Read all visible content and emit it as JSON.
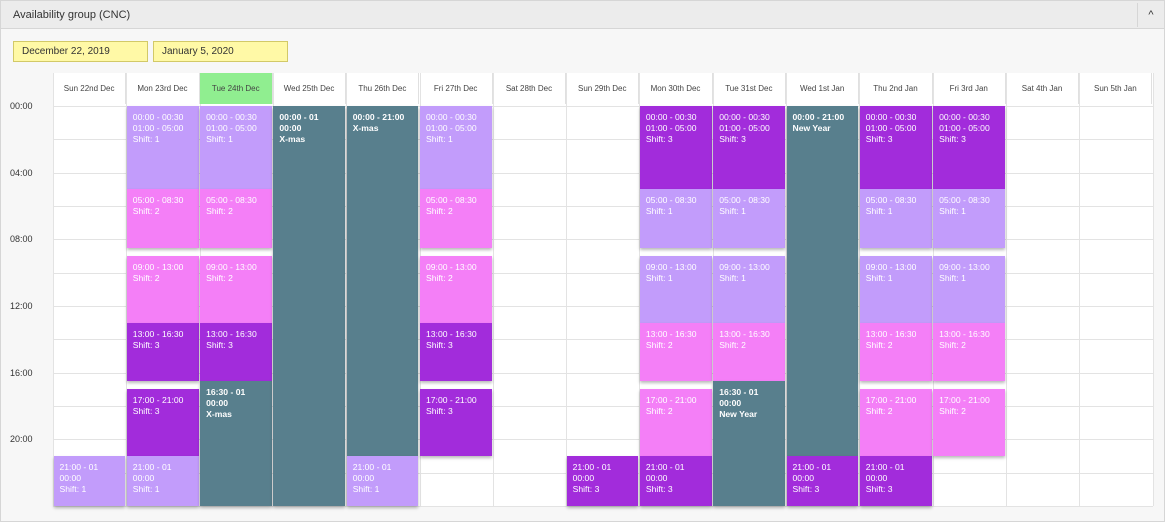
{
  "panel": {
    "title": "Availability group (CNC)",
    "collapse_icon": "^"
  },
  "filters": {
    "start_date": "December 22, 2019",
    "end_date": "January 5, 2020"
  },
  "days": [
    {
      "label": "Sun 22nd Dec",
      "today": false
    },
    {
      "label": "Mon 23rd Dec",
      "today": false
    },
    {
      "label": "Tue 24th Dec",
      "today": true
    },
    {
      "label": "Wed 25th Dec",
      "today": false
    },
    {
      "label": "Thu 26th Dec",
      "today": false
    },
    {
      "label": "Fri 27th Dec",
      "today": false
    },
    {
      "label": "Sat 28th Dec",
      "today": false
    },
    {
      "label": "Sun 29th Dec",
      "today": false
    },
    {
      "label": "Mon 30th Dec",
      "today": false
    },
    {
      "label": "Tue 31st Dec",
      "today": false
    },
    {
      "label": "Wed 1st Jan",
      "today": false
    },
    {
      "label": "Thu 2nd Jan",
      "today": false
    },
    {
      "label": "Fri 3rd Jan",
      "today": false
    },
    {
      "label": "Sat 4th Jan",
      "today": false
    },
    {
      "label": "Sun 5th Jan",
      "today": false
    }
  ],
  "time_labels": [
    "00:00",
    "04:00",
    "08:00",
    "12:00",
    "16:00",
    "20:00"
  ],
  "colors": {
    "lavender": "#c29cfb",
    "pink": "#f47ff7",
    "purple": "#a22cdb",
    "teal": "#587f8d",
    "today": "#90ee90",
    "date_input": "#fff9a6"
  },
  "events": [
    {
      "day": 1,
      "start": 0,
      "end": 5,
      "color": "lavender",
      "lines": [
        {
          "t": "00:00 - 00:30",
          "b": false
        },
        {
          "t": "01:00 - 05:00",
          "b": false
        },
        {
          "t": "Shift: 1",
          "b": false
        }
      ]
    },
    {
      "day": 1,
      "start": 5,
      "end": 8.5,
      "color": "pink",
      "lines": [
        {
          "t": "05:00 - 08:30",
          "b": false
        },
        {
          "t": "Shift: 2",
          "b": false
        }
      ]
    },
    {
      "day": 1,
      "start": 9,
      "end": 13,
      "color": "pink",
      "lines": [
        {
          "t": "09:00 - 13:00",
          "b": false
        },
        {
          "t": "Shift: 2",
          "b": false
        }
      ]
    },
    {
      "day": 1,
      "start": 13,
      "end": 16.5,
      "color": "purple",
      "lines": [
        {
          "t": "13:00 - 16:30",
          "b": false
        },
        {
          "t": "Shift: 3",
          "b": false
        }
      ]
    },
    {
      "day": 1,
      "start": 17,
      "end": 21,
      "color": "purple",
      "lines": [
        {
          "t": "17:00 - 21:00",
          "b": false
        },
        {
          "t": "Shift: 3",
          "b": false
        }
      ]
    },
    {
      "day": 1,
      "start": 21,
      "end": 24,
      "color": "lavender",
      "lines": [
        {
          "t": "21:00 - 01",
          "b": false
        },
        {
          "t": "00:00",
          "b": false
        },
        {
          "t": "Shift: 1",
          "b": false
        }
      ]
    },
    {
      "day": 2,
      "start": 0,
      "end": 5,
      "color": "lavender",
      "lines": [
        {
          "t": "00:00 - 00:30",
          "b": false
        },
        {
          "t": "01:00 - 05:00",
          "b": false
        },
        {
          "t": "Shift: 1",
          "b": false
        }
      ]
    },
    {
      "day": 2,
      "start": 5,
      "end": 8.5,
      "color": "pink",
      "lines": [
        {
          "t": "05:00 - 08:30",
          "b": false
        },
        {
          "t": "Shift: 2",
          "b": false
        }
      ]
    },
    {
      "day": 2,
      "start": 9,
      "end": 13,
      "color": "pink",
      "lines": [
        {
          "t": "09:00 - 13:00",
          "b": false
        },
        {
          "t": "Shift: 2",
          "b": false
        }
      ]
    },
    {
      "day": 2,
      "start": 13,
      "end": 16.5,
      "color": "purple",
      "lines": [
        {
          "t": "13:00 - 16:30",
          "b": false
        },
        {
          "t": "Shift: 3",
          "b": false
        }
      ]
    },
    {
      "day": 2,
      "start": 16.5,
      "end": 24,
      "color": "teal",
      "lines": [
        {
          "t": "16:30 - 01",
          "b": true
        },
        {
          "t": "00:00",
          "b": true
        },
        {
          "t": "X-mas",
          "b": true
        }
      ]
    },
    {
      "day": 3,
      "start": 0,
      "end": 24,
      "color": "teal",
      "lines": [
        {
          "t": "00:00 - 01",
          "b": true
        },
        {
          "t": "00:00",
          "b": true
        },
        {
          "t": "X-mas",
          "b": true
        }
      ]
    },
    {
      "day": 4,
      "start": 0,
      "end": 21,
      "color": "teal",
      "lines": [
        {
          "t": "00:00 - 21:00",
          "b": true
        },
        {
          "t": "X-mas",
          "b": true
        }
      ]
    },
    {
      "day": 4,
      "start": 21,
      "end": 24,
      "color": "lavender",
      "lines": [
        {
          "t": "21:00 - 01",
          "b": false
        },
        {
          "t": "00:00",
          "b": false
        },
        {
          "t": "Shift: 1",
          "b": false
        }
      ]
    },
    {
      "day": 5,
      "start": 0,
      "end": 5,
      "color": "lavender",
      "lines": [
        {
          "t": "00:00 - 00:30",
          "b": false
        },
        {
          "t": "01:00 - 05:00",
          "b": false
        },
        {
          "t": "Shift: 1",
          "b": false
        }
      ]
    },
    {
      "day": 5,
      "start": 5,
      "end": 8.5,
      "color": "pink",
      "lines": [
        {
          "t": "05:00 - 08:30",
          "b": false
        },
        {
          "t": "Shift: 2",
          "b": false
        }
      ]
    },
    {
      "day": 5,
      "start": 9,
      "end": 13,
      "color": "pink",
      "lines": [
        {
          "t": "09:00 - 13:00",
          "b": false
        },
        {
          "t": "Shift: 2",
          "b": false
        }
      ]
    },
    {
      "day": 5,
      "start": 13,
      "end": 16.5,
      "color": "purple",
      "lines": [
        {
          "t": "13:00 - 16:30",
          "b": false
        },
        {
          "t": "Shift: 3",
          "b": false
        }
      ]
    },
    {
      "day": 5,
      "start": 17,
      "end": 21,
      "color": "purple",
      "lines": [
        {
          "t": "17:00 - 21:00",
          "b": false
        },
        {
          "t": "Shift: 3",
          "b": false
        }
      ]
    },
    {
      "day": 0,
      "start": 21,
      "end": 24,
      "color": "lavender",
      "lines": [
        {
          "t": "21:00 - 01",
          "b": false
        },
        {
          "t": "00:00",
          "b": false
        },
        {
          "t": "Shift: 1",
          "b": false
        }
      ]
    },
    {
      "day": 7,
      "start": 21,
      "end": 24,
      "color": "purple",
      "lines": [
        {
          "t": "21:00 - 01",
          "b": false
        },
        {
          "t": "00:00",
          "b": false
        },
        {
          "t": "Shift: 3",
          "b": false
        }
      ]
    },
    {
      "day": 8,
      "start": 0,
      "end": 5,
      "color": "purple",
      "lines": [
        {
          "t": "00:00 - 00:30",
          "b": false
        },
        {
          "t": "01:00 - 05:00",
          "b": false
        },
        {
          "t": "Shift: 3",
          "b": false
        }
      ]
    },
    {
      "day": 8,
      "start": 5,
      "end": 8.5,
      "color": "lavender",
      "lines": [
        {
          "t": "05:00 - 08:30",
          "b": false
        },
        {
          "t": "Shift: 1",
          "b": false
        }
      ]
    },
    {
      "day": 8,
      "start": 9,
      "end": 13,
      "color": "lavender",
      "lines": [
        {
          "t": "09:00 - 13:00",
          "b": false
        },
        {
          "t": "Shift: 1",
          "b": false
        }
      ]
    },
    {
      "day": 8,
      "start": 13,
      "end": 16.5,
      "color": "pink",
      "lines": [
        {
          "t": "13:00 - 16:30",
          "b": false
        },
        {
          "t": "Shift: 2",
          "b": false
        }
      ]
    },
    {
      "day": 8,
      "start": 17,
      "end": 21,
      "color": "pink",
      "lines": [
        {
          "t": "17:00 - 21:00",
          "b": false
        },
        {
          "t": "Shift: 2",
          "b": false
        }
      ]
    },
    {
      "day": 8,
      "start": 21,
      "end": 24,
      "color": "purple",
      "lines": [
        {
          "t": "21:00 - 01",
          "b": false
        },
        {
          "t": "00:00",
          "b": false
        },
        {
          "t": "Shift: 3",
          "b": false
        }
      ]
    },
    {
      "day": 9,
      "start": 0,
      "end": 5,
      "color": "purple",
      "lines": [
        {
          "t": "00:00 - 00:30",
          "b": false
        },
        {
          "t": "01:00 - 05:00",
          "b": false
        },
        {
          "t": "Shift: 3",
          "b": false
        }
      ]
    },
    {
      "day": 9,
      "start": 5,
      "end": 8.5,
      "color": "lavender",
      "lines": [
        {
          "t": "05:00 - 08:30",
          "b": false
        },
        {
          "t": "Shift: 1",
          "b": false
        }
      ]
    },
    {
      "day": 9,
      "start": 9,
      "end": 13,
      "color": "lavender",
      "lines": [
        {
          "t": "09:00 - 13:00",
          "b": false
        },
        {
          "t": "Shift: 1",
          "b": false
        }
      ]
    },
    {
      "day": 9,
      "start": 13,
      "end": 16.5,
      "color": "pink",
      "lines": [
        {
          "t": "13:00 - 16:30",
          "b": false
        },
        {
          "t": "Shift: 2",
          "b": false
        }
      ]
    },
    {
      "day": 9,
      "start": 16.5,
      "end": 24,
      "color": "teal",
      "lines": [
        {
          "t": "16:30 - 01",
          "b": true
        },
        {
          "t": "00:00",
          "b": true
        },
        {
          "t": "New Year",
          "b": true
        }
      ]
    },
    {
      "day": 10,
      "start": 0,
      "end": 21,
      "color": "teal",
      "lines": [
        {
          "t": "00:00 - 21:00",
          "b": true
        },
        {
          "t": "New Year",
          "b": true
        }
      ]
    },
    {
      "day": 10,
      "start": 21,
      "end": 24,
      "color": "purple",
      "lines": [
        {
          "t": "21:00 - 01",
          "b": false
        },
        {
          "t": "00:00",
          "b": false
        },
        {
          "t": "Shift: 3",
          "b": false
        }
      ]
    },
    {
      "day": 11,
      "start": 0,
      "end": 5,
      "color": "purple",
      "lines": [
        {
          "t": "00:00 - 00:30",
          "b": false
        },
        {
          "t": "01:00 - 05:00",
          "b": false
        },
        {
          "t": "Shift: 3",
          "b": false
        }
      ]
    },
    {
      "day": 11,
      "start": 5,
      "end": 8.5,
      "color": "lavender",
      "lines": [
        {
          "t": "05:00 - 08:30",
          "b": false
        },
        {
          "t": "Shift: 1",
          "b": false
        }
      ]
    },
    {
      "day": 11,
      "start": 9,
      "end": 13,
      "color": "lavender",
      "lines": [
        {
          "t": "09:00 - 13:00",
          "b": false
        },
        {
          "t": "Shift: 1",
          "b": false
        }
      ]
    },
    {
      "day": 11,
      "start": 13,
      "end": 16.5,
      "color": "pink",
      "lines": [
        {
          "t": "13:00 - 16:30",
          "b": false
        },
        {
          "t": "Shift: 2",
          "b": false
        }
      ]
    },
    {
      "day": 11,
      "start": 17,
      "end": 21,
      "color": "pink",
      "lines": [
        {
          "t": "17:00 - 21:00",
          "b": false
        },
        {
          "t": "Shift: 2",
          "b": false
        }
      ]
    },
    {
      "day": 11,
      "start": 21,
      "end": 24,
      "color": "purple",
      "lines": [
        {
          "t": "21:00 - 01",
          "b": false
        },
        {
          "t": "00:00",
          "b": false
        },
        {
          "t": "Shift: 3",
          "b": false
        }
      ]
    },
    {
      "day": 12,
      "start": 0,
      "end": 5,
      "color": "purple",
      "lines": [
        {
          "t": "00:00 - 00:30",
          "b": false
        },
        {
          "t": "01:00 - 05:00",
          "b": false
        },
        {
          "t": "Shift: 3",
          "b": false
        }
      ]
    },
    {
      "day": 12,
      "start": 5,
      "end": 8.5,
      "color": "lavender",
      "lines": [
        {
          "t": "05:00 - 08:30",
          "b": false
        },
        {
          "t": "Shift: 1",
          "b": false
        }
      ]
    },
    {
      "day": 12,
      "start": 9,
      "end": 13,
      "color": "lavender",
      "lines": [
        {
          "t": "09:00 - 13:00",
          "b": false
        },
        {
          "t": "Shift: 1",
          "b": false
        }
      ]
    },
    {
      "day": 12,
      "start": 13,
      "end": 16.5,
      "color": "pink",
      "lines": [
        {
          "t": "13:00 - 16:30",
          "b": false
        },
        {
          "t": "Shift: 2",
          "b": false
        }
      ]
    },
    {
      "day": 12,
      "start": 17,
      "end": 21,
      "color": "pink",
      "lines": [
        {
          "t": "17:00 - 21:00",
          "b": false
        },
        {
          "t": "Shift: 2",
          "b": false
        }
      ]
    }
  ]
}
